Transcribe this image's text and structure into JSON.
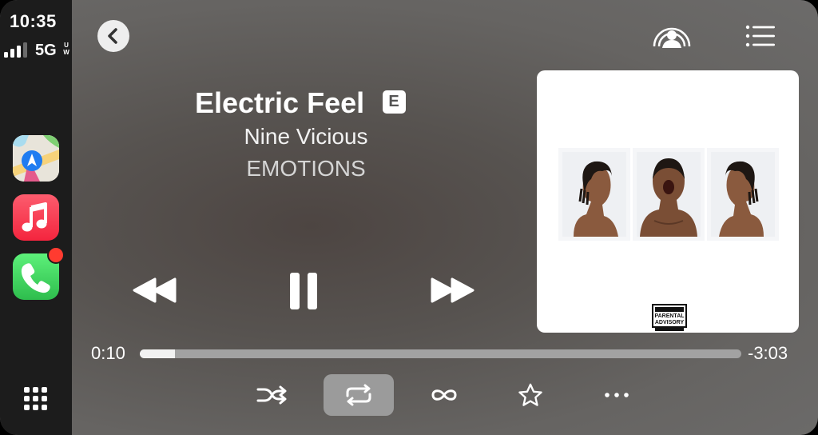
{
  "status": {
    "time": "10:35",
    "network": "5G",
    "network_suffix_top": "U",
    "network_suffix_bottom": "W",
    "signal_bars_filled": 3
  },
  "sidebar": {
    "apps": [
      {
        "name": "Maps",
        "icon": "maps-icon"
      },
      {
        "name": "Music",
        "icon": "music-icon"
      },
      {
        "name": "Phone",
        "icon": "phone-icon",
        "badge": true
      }
    ],
    "app_grid_icon": "app-grid-icon"
  },
  "now_playing": {
    "title": "Electric Feel",
    "explicit_badge": "E",
    "artist": "Nine Vicious",
    "album": "EMOTIONS",
    "artwork_label": "PARENTAL ADVISORY"
  },
  "playback": {
    "elapsed": "0:10",
    "remaining": "-3:03",
    "progress": 0.058,
    "state": "playing",
    "repeat_active": true
  },
  "controls": [
    "rewind-icon",
    "pause-icon",
    "fast-forward-icon"
  ],
  "bottom_controls": [
    "shuffle-icon",
    "repeat-icon",
    "infinity-icon",
    "star-icon",
    "more-icon"
  ],
  "colors": {
    "sidebar_bg": "#1c1c1c",
    "music_app": "#f4253e",
    "phone_app": "#2ebd4d",
    "badge": "#ff3b30",
    "repeat_active_bg": "#9b9b9b"
  }
}
